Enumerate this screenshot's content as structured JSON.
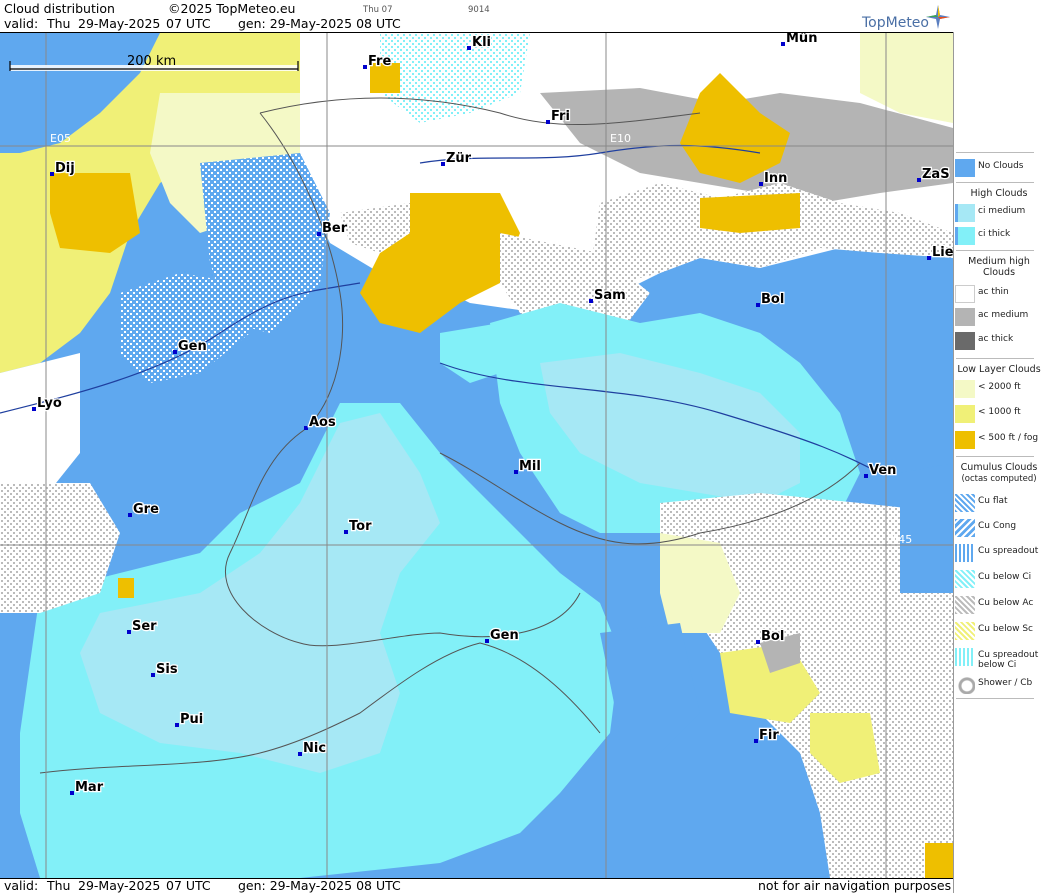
{
  "header": {
    "title": "Cloud distribution",
    "copyright": "©2025 TopMeteo.eu",
    "small1": "Thu 07",
    "small2": "9014",
    "valid_label": "valid:",
    "valid_day": "Thu",
    "valid_date": "29-May-2025",
    "valid_time": "07 UTC",
    "gen": "gen: 29-May-2025 08 UTC",
    "brand": "TopMeteo"
  },
  "footer": {
    "valid_label": "valid:",
    "valid_day": "Thu",
    "valid_date": "29-May-2025",
    "valid_time": "07 UTC",
    "gen": "gen: 29-May-2025 08 UTC",
    "disclaimer": "not for air navigation purposes"
  },
  "map": {
    "scale_label": "200 km",
    "grid_labels": [
      "E05",
      "E10",
      "N45"
    ],
    "cities": [
      "Mün",
      "Kli",
      "Fre",
      "Fri",
      "Dij",
      "Zür",
      "Inn",
      "ZaS",
      "Ber",
      "Lie",
      "Sam",
      "Bol",
      "Gen",
      "Lyo",
      "Aos",
      "Mil",
      "Ven",
      "Gre",
      "Tor",
      "Ser",
      "Gen",
      "Bol",
      "Sis",
      "Pui",
      "Nic",
      "Fir",
      "Mar"
    ]
  },
  "legend": {
    "no_clouds": "No Clouds",
    "high_title": "High Clouds",
    "ci_medium": "ci medium",
    "ci_thick": "ci thick",
    "medium_title_1": "Medium high",
    "medium_title_2": "Clouds",
    "ac_thin": "ac thin",
    "ac_medium": "ac medium",
    "ac_thick": "ac thick",
    "low_title": "Low Layer Clouds",
    "low_2000": "< 2000 ft",
    "low_1000": "< 1000 ft",
    "low_500": "< 500 ft / fog",
    "cu_title_1": "Cumulus Clouds",
    "cu_title_2": "(octas computed)",
    "cu_flat": "Cu flat",
    "cu_cong": "Cu Cong",
    "cu_spreadout": "Cu spreadout",
    "cu_below_ci": "Cu below Ci",
    "cu_below_ac": "Cu below Ac",
    "cu_below_sc": "Cu below Sc",
    "cu_spread_below_ci_1": "Cu spreadout",
    "cu_spread_below_ci_2": "below Ci",
    "shower": "Shower / Cb"
  },
  "colors": {
    "no_clouds": "#5fa8ef",
    "ci_medium": "#a6e8f5",
    "ci_thick": "#82f0f8",
    "ac_thin": "#ffffff",
    "ac_medium": "#b4b4b4",
    "ac_thick": "#6a6a6a",
    "low_2000": "#f4f9c6",
    "low_1000": "#f0f077",
    "low_500": "#eebf00"
  }
}
